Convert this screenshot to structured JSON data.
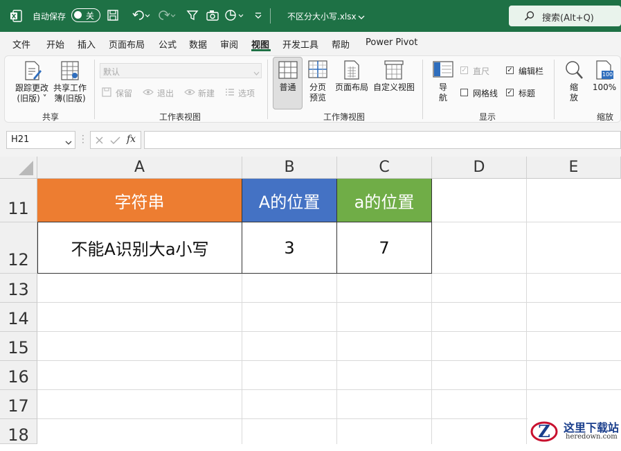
{
  "titlebar": {
    "autosave_label": "自动保存",
    "autosave_state": "关",
    "filename": "不区分大小写.xlsx",
    "search_placeholder": "搜索(Alt+Q)"
  },
  "menu": [
    "文件",
    "开始",
    "插入",
    "页面布局",
    "公式",
    "数据",
    "审阅",
    "视图",
    "开发工具",
    "帮助",
    "Power Pivot"
  ],
  "menu_active": "视图",
  "ribbon": {
    "share": {
      "track_changes": [
        "跟踪更改",
        "(旧版) ˅"
      ],
      "share_workbook": [
        "共享工作",
        "簿(旧版)"
      ],
      "group_label": "共享"
    },
    "sheet_view": {
      "select_value": "默认",
      "keep": "保留",
      "exit": "退出",
      "new": "新建",
      "options": "选项",
      "group_label": "工作表视图"
    },
    "workbook_view": {
      "normal": "普通",
      "page_break": [
        "分页",
        "预览"
      ],
      "page_layout": "页面布局",
      "custom_views": "自定义视图",
      "group_label": "工作簿视图"
    },
    "show": {
      "navigate": [
        "导",
        "航"
      ],
      "ruler": "直尺",
      "formula_bar": "编辑栏",
      "gridlines": "网格线",
      "headings": "标题",
      "group_label": "显示"
    },
    "zoom": {
      "zoom": [
        "缩",
        "放"
      ],
      "zoom_100": "100%",
      "zoom_100_badge": "100",
      "group_label": "缩放"
    }
  },
  "formula_bar": {
    "name_box": "H21",
    "fx": "fx",
    "formula": ""
  },
  "sheet": {
    "columns": [
      "A",
      "B",
      "C",
      "D",
      "E"
    ],
    "rows": [
      "11",
      "12",
      "13",
      "14",
      "15",
      "16",
      "17",
      "18"
    ],
    "header": [
      "字符串",
      "A的位置",
      "a的位置"
    ],
    "data_row": [
      "不能A识别大a小写",
      "3",
      "7"
    ]
  },
  "colors": {
    "title_bar": "#1e7145",
    "header_a": "#ed7d31",
    "header_b": "#4472c4",
    "header_c": "#70ad47"
  },
  "watermark": {
    "name": "这里下载站",
    "url": "heredown.com"
  }
}
